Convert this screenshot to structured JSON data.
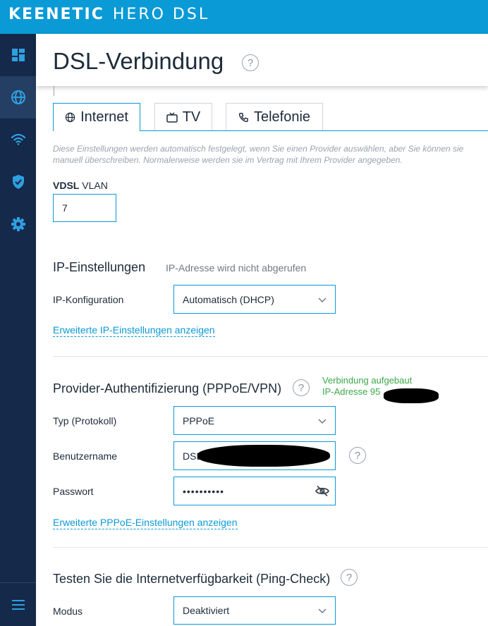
{
  "brand": {
    "name": "KEENETIC",
    "model": "HERO DSL"
  },
  "colors": {
    "accent": "#0a9ad6",
    "sidebar": "#15294a",
    "status_ok": "#3aa84a"
  },
  "sidebar": {
    "items": [
      {
        "name": "dashboard",
        "icon": "dashboard-icon",
        "active": false
      },
      {
        "name": "internet",
        "icon": "globe-icon",
        "active": true
      },
      {
        "name": "wifi",
        "icon": "wifi-icon",
        "active": false
      },
      {
        "name": "security",
        "icon": "shield-check-icon",
        "active": false
      },
      {
        "name": "settings",
        "icon": "gear-icon",
        "active": false
      }
    ],
    "menu_icon": "hamburger-menu-icon"
  },
  "header": {
    "title": "DSL-Verbindung",
    "help": "?"
  },
  "tabs": [
    {
      "label": "Internet",
      "icon": "globe-icon",
      "active": true
    },
    {
      "label": "TV",
      "icon": "tv-icon",
      "active": false
    },
    {
      "label": "Telefonie",
      "icon": "phone-icon",
      "active": false
    }
  ],
  "note": "Diese Einstellungen werden automatisch festgelegt, wenn Sie einen Provider auswählen, aber Sie können sie manuell überschreiben. Normalerweise werden sie im Vertrag mit Ihrem Provider angegeben.",
  "vlan": {
    "label_bold": "VDSL",
    "label_rest": "VLAN",
    "value": "7"
  },
  "ip": {
    "title": "IP-Einstellungen",
    "status": "IP-Adresse wird nicht abgerufen",
    "config_label": "IP-Konfiguration",
    "config_value": "Automatisch (DHCP)",
    "advanced_link": "Erweiterte IP-Einstellungen anzeigen"
  },
  "pppoe": {
    "title": "Provider-Authentifizierung (PPPoE/VPN)",
    "help": "?",
    "status_line1": "Verbindung aufgebaut",
    "status_line2": "IP-Adresse 95",
    "type_label": "Typ (Protokoll)",
    "type_value": "PPPoE",
    "user_label": "Benutzername",
    "user_value": "DSL",
    "user_help": "?",
    "pass_label": "Passwort",
    "pass_value": "••••••••••",
    "advanced_link": "Erweiterte PPPoE-Einstellungen anzeigen"
  },
  "ping": {
    "title": "Testen Sie die Internetverfügbarkeit (Ping-Check)",
    "help": "?",
    "mode_label": "Modus",
    "mode_value": "Deaktiviert"
  }
}
